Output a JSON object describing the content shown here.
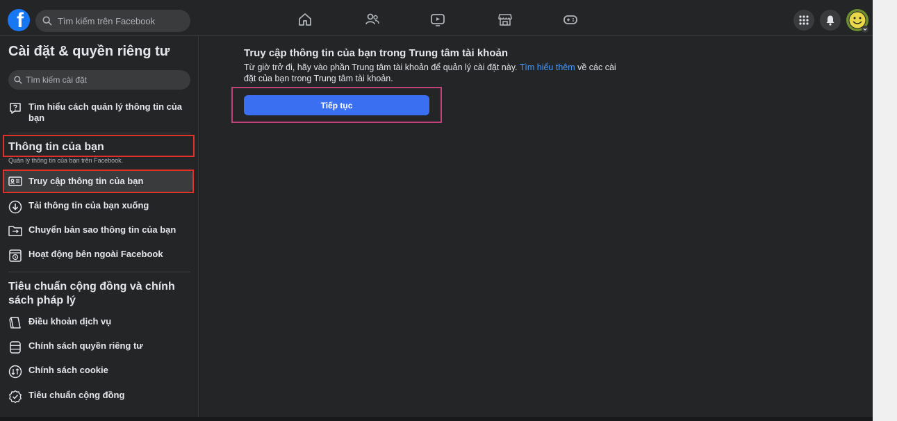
{
  "header": {
    "search_placeholder": "Tìm kiếm trên Facebook",
    "nav_icons": [
      "home-icon",
      "friends-icon",
      "watch-icon",
      "marketplace-icon",
      "gaming-icon"
    ],
    "right_icons": [
      "menu-grid-icon",
      "notifications-icon",
      "avatar"
    ]
  },
  "sidebar": {
    "title": "Cài đặt & quyền riêng tư",
    "search_placeholder": "Tìm kiếm cài đặt",
    "help_item": "Tìm hiểu cách quản lý thông tin của bạn",
    "section1": {
      "title": "Thông tin của bạn",
      "subtitle": "Quản lý thông tin của bạn trên Facebook.",
      "items": [
        "Truy cập thông tin của bạn",
        "Tải thông tin của bạn xuống",
        "Chuyển bản sao thông tin của bạn",
        "Hoạt động bên ngoài Facebook"
      ]
    },
    "section2": {
      "title_line1": "Tiêu chuẩn cộng đồng và chính",
      "title_line2": "sách pháp lý",
      "items": [
        "Điều khoản dịch vụ",
        "Chính sách quyền riêng tư",
        "Chính sách cookie",
        "Tiêu chuẩn cộng đồng"
      ]
    }
  },
  "main": {
    "title": "Truy cập thông tin của bạn trong Trung tâm tài khoản",
    "desc_before": "Từ giờ trở đi, hãy vào phần Trung tâm tài khoản để quản lý cài đặt này. ",
    "desc_link": "Tìm hiểu thêm",
    "desc_after": " về các cài đặt của bạn trong Trung tâm tài khoản.",
    "button": "Tiếp tục"
  },
  "colors": {
    "accent": "#3b6ff2",
    "link": "#4599ff",
    "highlight_red": "#e0312a",
    "highlight_pink": "#c3407a"
  }
}
